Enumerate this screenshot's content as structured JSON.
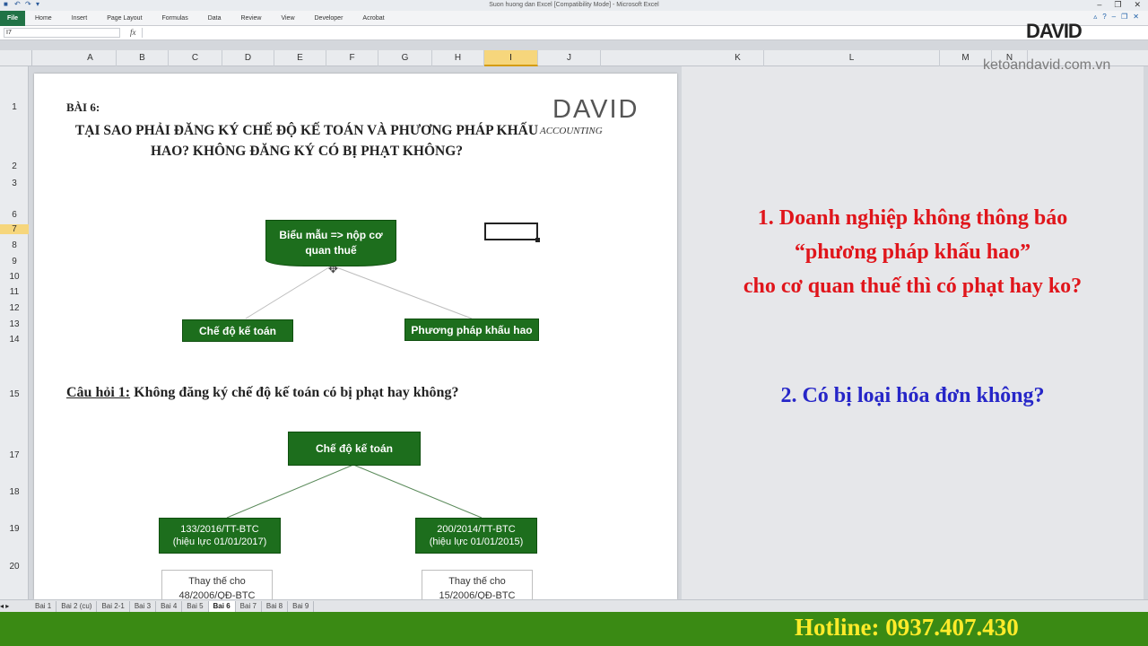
{
  "window": {
    "title": "Suon huong dan Excel  [Compatibility Mode]  -  Microsoft Excel"
  },
  "ribbon": {
    "file": "File",
    "tabs": [
      "Home",
      "Insert",
      "Page Layout",
      "Formulas",
      "Data",
      "Review",
      "View",
      "Developer",
      "Acrobat"
    ]
  },
  "formula_bar": {
    "name_box": "I7",
    "fx": "fx"
  },
  "columns": [
    "A",
    "B",
    "C",
    "D",
    "E",
    "F",
    "G",
    "H",
    "I",
    "J",
    "K",
    "L",
    "M",
    "N"
  ],
  "selected_column": "I",
  "rows": [
    "1",
    "2",
    "3",
    "6",
    "7",
    "8",
    "9",
    "10",
    "11",
    "12",
    "13",
    "14",
    "15",
    "17",
    "18",
    "19",
    "20"
  ],
  "selected_row": "7",
  "page": {
    "lesson": "BÀI 6:",
    "title": "TẠI SAO PHẢI ĐĂNG KÝ CHẾ ĐỘ KẾ TOÁN VÀ PHƯƠNG PHÁP KHẤU HAO? KHÔNG ĐĂNG KÝ CÓ BỊ PHẠT KHÔNG?",
    "logo_main": "DAVID",
    "logo_sub": "ACCOUNTING",
    "box_submit": "Biểu mẫu => nộp cơ quan thuế",
    "box_regime": "Chế độ kế toán",
    "box_depreciation": "Phương pháp khấu hao",
    "question_label": "Câu hỏi 1:",
    "question_text": " Không đăng ký chế độ kế toán có bị phạt hay không?",
    "box_regime2": "Chế độ kế toán",
    "box_circular1": "133/2016/TT-BTC (hiệu lực 01/01/2017)",
    "box_circular2": "200/2014/TT-BTC (hiệu lực 01/01/2015)",
    "box_replace1": "Thay thế cho 48/2006/QĐ-BTC",
    "box_replace2": "Thay thế cho 15/2006/QĐ-BTC"
  },
  "right_pane": {
    "q1_line1": "1. Doanh nghiệp không thông báo",
    "q1_line2": "“phương pháp khấu hao”",
    "q1_line3": "cho cơ quan thuế thì có phạt hay ko?",
    "q2": "2. Có bị loại hóa đơn không?"
  },
  "brand": {
    "logo": "DAVID",
    "site": "ketoandavid.com.vn"
  },
  "sheets": [
    "Bai 1",
    "Bai 2 (cu)",
    "Bai 2-1",
    "Bai 3",
    "Bai 4",
    "Bai 5",
    "Bai 6",
    "Bai 7",
    "Bai 8",
    "Bai 9"
  ],
  "active_sheet": "Bai 6",
  "hotline": "Hotline: 0937.407.430",
  "colors": {
    "excel_green": "#217346",
    "box_green": "#1d6e1d",
    "question_red": "#e0151b",
    "question_blue": "#2626c8",
    "hotline_bar": "#3a8a14",
    "hotline_text": "#ffeb2a"
  }
}
